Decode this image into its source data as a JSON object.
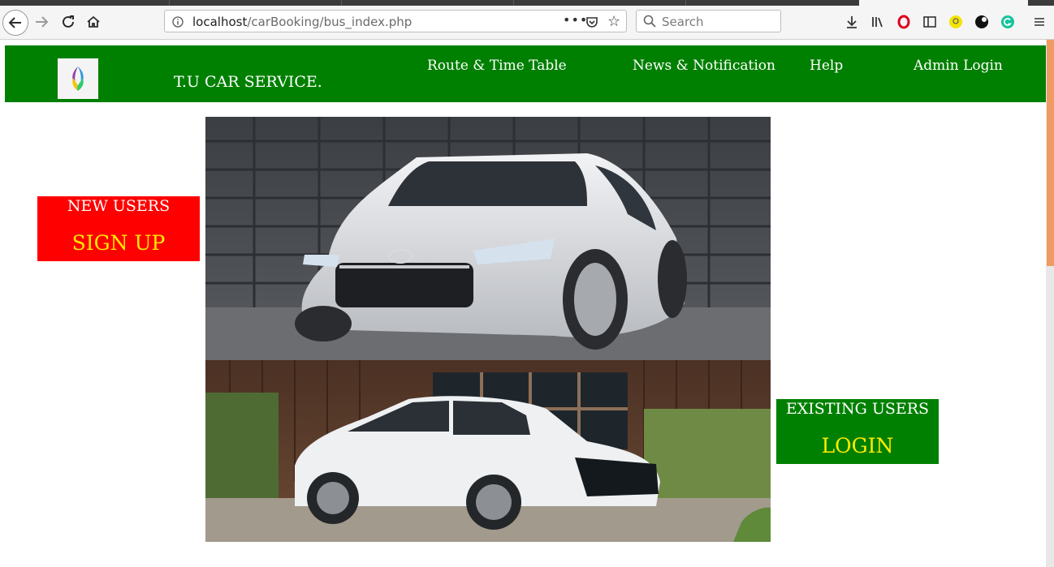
{
  "browser": {
    "url_host": "localhost",
    "url_path": "/carBooking/bus_index.php",
    "search_placeholder": "Search"
  },
  "header": {
    "site_title": "T.U CAR SERVICE.",
    "nav": [
      {
        "label": "Route & Time Table"
      },
      {
        "label": "News & Notification"
      },
      {
        "label": "Help"
      },
      {
        "label": "Admin Login"
      }
    ]
  },
  "signup_box": {
    "caption": "NEW USERS",
    "action": "SIGN UP",
    "color": "#ff0000"
  },
  "login_box": {
    "caption": "EXISTING USERS",
    "action": "LOGIN",
    "color": "#008000"
  },
  "colors": {
    "header_bg": "#008000",
    "accent_text": "#ffeb00"
  },
  "images": [
    {
      "description_icon": "white-sedan-front-icon"
    },
    {
      "description_icon": "white-sedan-side-icon"
    }
  ]
}
